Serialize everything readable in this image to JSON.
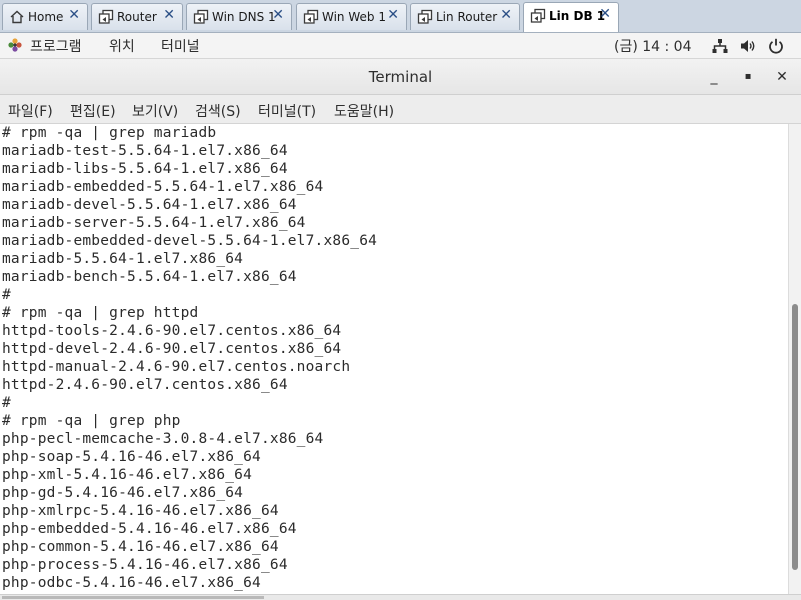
{
  "tabs": [
    {
      "label": "Home",
      "icon": "home-icon",
      "active": false
    },
    {
      "label": "Router",
      "icon": "vm-icon",
      "active": false
    },
    {
      "label": "Win DNS 1",
      "icon": "vm-icon",
      "active": false
    },
    {
      "label": "Win Web 1",
      "icon": "vm-icon",
      "active": false
    },
    {
      "label": "Lin Router",
      "icon": "vm-icon",
      "active": false
    },
    {
      "label": "Lin DB 1",
      "icon": "vm-icon",
      "active": true
    }
  ],
  "tab_close_glyph": "✕",
  "topbar": {
    "menus": [
      "프로그램",
      "위치",
      "터미널"
    ],
    "clock": "(금) 14 : 04",
    "status_icons": [
      "network-icon",
      "volume-icon",
      "power-icon"
    ]
  },
  "window": {
    "title": "Terminal",
    "minimize": "_",
    "maximize": "▪",
    "close": "✕"
  },
  "terminal_menu": [
    "파일(F)",
    "편집(E)",
    "보기(V)",
    "검색(S)",
    "터미널(T)",
    "도움말(H)"
  ],
  "terminal_lines": [
    "# rpm -qa | grep mariadb",
    "mariadb-test-5.5.64-1.el7.x86_64",
    "mariadb-libs-5.5.64-1.el7.x86_64",
    "mariadb-embedded-5.5.64-1.el7.x86_64",
    "mariadb-devel-5.5.64-1.el7.x86_64",
    "mariadb-server-5.5.64-1.el7.x86_64",
    "mariadb-embedded-devel-5.5.64-1.el7.x86_64",
    "mariadb-5.5.64-1.el7.x86_64",
    "mariadb-bench-5.5.64-1.el7.x86_64",
    "#",
    "# rpm -qa | grep httpd",
    "httpd-tools-2.4.6-90.el7.centos.x86_64",
    "httpd-devel-2.4.6-90.el7.centos.x86_64",
    "httpd-manual-2.4.6-90.el7.centos.noarch",
    "httpd-2.4.6-90.el7.centos.x86_64",
    "#",
    "# rpm -qa | grep php",
    "php-pecl-memcache-3.0.8-4.el7.x86_64",
    "php-soap-5.4.16-46.el7.x86_64",
    "php-xml-5.4.16-46.el7.x86_64",
    "php-gd-5.4.16-46.el7.x86_64",
    "php-xmlrpc-5.4.16-46.el7.x86_64",
    "php-embedded-5.4.16-46.el7.x86_64",
    "php-common-5.4.16-46.el7.x86_64",
    "php-process-5.4.16-46.el7.x86_64",
    "php-odbc-5.4.16-46.el7.x86_64"
  ],
  "colors": {
    "tab_close": "#2a4f86",
    "tab_strip": "#ccd6e2",
    "terminal_text": "#2b2b2b"
  }
}
